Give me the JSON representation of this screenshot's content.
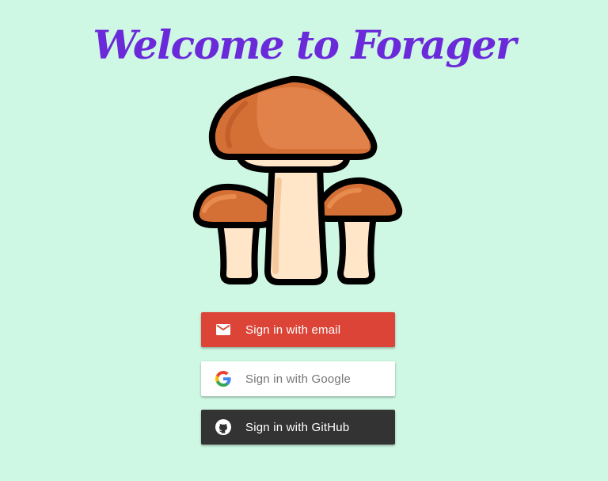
{
  "title": "Welcome to Forager",
  "logo": {
    "icon": "mushroom-icon"
  },
  "buttons": {
    "email": {
      "label": "Sign in with email",
      "icon": "mail-icon",
      "color": "#db4437"
    },
    "google": {
      "label": "Sign in with Google",
      "icon": "google-icon",
      "color": "#ffffff"
    },
    "github": {
      "label": "Sign in with GitHub",
      "icon": "github-icon",
      "color": "#333333"
    }
  },
  "colors": {
    "background": "#cef8e3",
    "title": "#6a2ad9"
  }
}
